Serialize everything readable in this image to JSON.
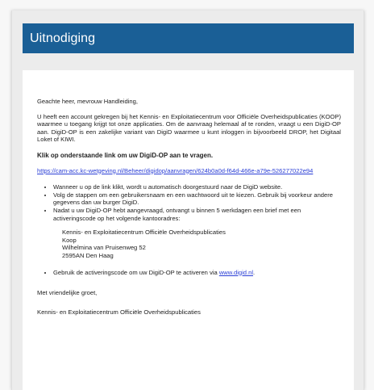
{
  "banner": {
    "title": "Uitnodiging"
  },
  "colors": {
    "banner": "#1a5f96",
    "link": "#2b3fd6"
  },
  "message": {
    "greeting": "Geachte heer, mevrouw Handleiding,",
    "intro": "U heeft een account gekregen bij het Kennis- en Exploitatiecentrum voor Officiële Overheidspublicaties (KOOP) waarmee u toegang krijgt tot onze applicaties. Om de aanvraag helemaal af te ronden, vraagt u een DigiD-OP aan. DigiD-OP is een zakelijke variant van DigiD waarmee u kunt inloggen in bijvoorbeeld DROP, het Digitaal Loket of KIWI.",
    "cta": "Klik op onderstaande link om uw DigiD-OP aan te vragen.",
    "link": "https://cam-acc.kc-wetgeving.nl/Beheer/digidop/aanvragen/624b0a0d-f64d-466e-a79e-526277022e94",
    "steps": [
      "Wanneer u op de link klikt, wordt u automatisch doorgestuurd naar de DigiD website.",
      "Volg de stappen om een gebruikersnaam en een wachtwoord uit te kiezen. Gebruik bij voorkeur andere gegevens dan uw burger DigiD.",
      "Nadat u uw DigiD-OP hebt aangevraagd, ontvangt u binnen 5 werkdagen een brief met een activeringscode op het volgende kantooradres:"
    ],
    "address": [
      "Kennis- en Exploitatiecentrum Officiële Overheidspublicaties",
      "Koop",
      "Wilhelmina van Pruisenweg 52",
      "2595AN Den Haag"
    ],
    "final_step_prefix": "Gebruik de activeringscode om uw DigiD-OP te activeren via ",
    "final_step_link": "www.digid.nl",
    "final_step_suffix": ".",
    "closing": "Met vriendelijke groet,",
    "signature": "Kennis- en Exploitatiecentrum Officiële Overheidspublicaties"
  }
}
